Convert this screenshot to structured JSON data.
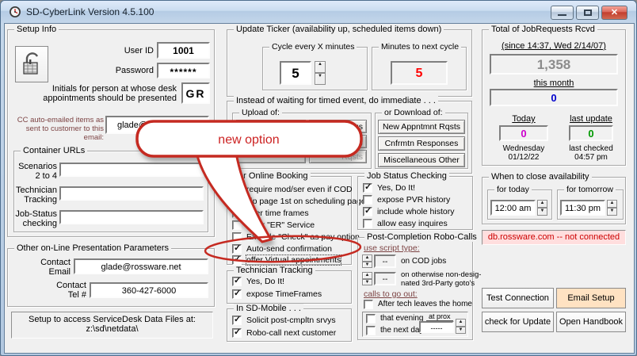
{
  "window": {
    "title": "SD-CyberLink Version 4.5.100"
  },
  "icons": {
    "spinner_up": "▲",
    "spinner_down": "▼",
    "close": "✕"
  },
  "callout": {
    "text": "new option"
  },
  "setup_info": {
    "label": "Setup Info",
    "user_id_label": "User ID",
    "user_id_value": "1001",
    "password_label": "Password",
    "password_value": "******",
    "initials_label_line1": "Initials for person at whose desk",
    "initials_label_line2": "appointments should be presented",
    "initials_value": "GR",
    "cc_label_line1": "CC auto-emailed items as",
    "cc_label_line2": "sent to customer to this email:",
    "cc_value": "glade@rossware.net",
    "container_urls": {
      "label": "Container URLs",
      "rows": [
        {
          "label_line1": "Scenarios",
          "label_line2": "2 to 4",
          "value": ""
        },
        {
          "label_line1": "Technician",
          "label_line2": "Tracking",
          "value": ""
        },
        {
          "label_line1": "Job-Status",
          "label_line2": "checking",
          "value": ""
        }
      ]
    }
  },
  "other_params": {
    "label": "Other on-Line Presentation Parameters",
    "email_label_line1": "Contact",
    "email_label_line2": "Email",
    "email_value": "glade@rossware.net",
    "tel_label_line1": "Contact",
    "tel_label_line2": "Tel #",
    "tel_value": "360-427-6000"
  },
  "data_files_note": {
    "line1": "Setup to access ServiceDesk Data Files at:",
    "line2": "z:\\sd\\netdata\\"
  },
  "update_ticker": {
    "label": "Update Ticker (availability up, scheduled items down)",
    "cycle_label": "Cycle every X minutes",
    "cycle_value": "5",
    "next_label": "Minutes to next cycle",
    "next_value": "5"
  },
  "immediate": {
    "label": "Instead of waiting for timed event, do immediate . . .",
    "upload": {
      "label": "Upload of:",
      "visible_fragments": [
        "tus",
        "king",
        "Rqsts"
      ]
    },
    "download": {
      "label": "or Download of:",
      "buttons": [
        "New Appntmnt Rqsts",
        "Cnfrmtn Responses",
        "Miscellaneous Other"
      ]
    }
  },
  "online_booking": {
    "label": "for Online Booking",
    "items": [
      {
        "label": "require mod/ser even if COD",
        "check": ""
      },
      {
        "label": "zip page 1st on scheduling page",
        "check": ""
      },
      {
        "label": "offer time frames",
        "check": "✓"
      },
      {
        "label": "Offer \"ER\" Service",
        "check": ""
      },
      {
        "label": "Exclude \"Check\" as pay option",
        "check": ""
      },
      {
        "label": "Auto-send confirmation",
        "check": "✓"
      },
      {
        "label": "offer Virtual appointments",
        "check": "✓"
      }
    ]
  },
  "technician_tracking": {
    "label": "Technician Tracking",
    "items": [
      {
        "label": "Yes, Do It!",
        "check": "✓"
      },
      {
        "label": "expose TimeFrames",
        "check": "✓"
      }
    ]
  },
  "sd_mobile": {
    "label": "In SD-Mobile . . .",
    "items": [
      {
        "label": "Solicit post-cmpltn srvys",
        "check": "✓"
      },
      {
        "label": "Robo-call next customer",
        "check": "✓"
      }
    ]
  },
  "job_status_checking": {
    "label": "Job Status Checking",
    "items": [
      {
        "label": "Yes, Do It!",
        "check": "✓"
      },
      {
        "label": "expose PVR history",
        "check": ""
      },
      {
        "label": "include whole history",
        "check": "✓"
      },
      {
        "label": "allow easy inquires",
        "check": ""
      }
    ]
  },
  "robo_calls": {
    "label": "Post-Completion Robo-Calls",
    "script_type_label": "use script type:",
    "cod_value": "--",
    "cod_text": "on COD jobs",
    "other_value": "--",
    "other_text_line1": "on otherwise non-desig-",
    "other_text_line2": "nated 3rd-Party goto's",
    "go_out_label": "calls to go out:",
    "after_tech": {
      "label": "After tech leaves the home",
      "check": ""
    },
    "that_evening": {
      "label": "that evening",
      "check": ""
    },
    "next_day": {
      "label": "the next day",
      "check": ""
    },
    "at_prox_label": "at prox",
    "at_prox_value": "-----"
  },
  "totals": {
    "label": "Total of JobRequests Rcvd",
    "since_label": "(since 14:37, Wed 2/14/07)",
    "total_value": "1,358",
    "month_label": "this month",
    "month_value": "0",
    "today_label": "Today",
    "today_value": "0",
    "today_day": "Wednesday",
    "today_date": "01/12/22",
    "update_label": "last update",
    "update_value": "0",
    "checked_label": "last checked",
    "checked_time": "04:57 pm"
  },
  "availability": {
    "label": "When to close availability",
    "today_label": "for today",
    "today_value": "12:00 am",
    "tomorrow_label": "for tomorrow",
    "tomorrow_value": "11:30 pm"
  },
  "status_text": "db.rossware.com -- not connected",
  "action_buttons": {
    "test": "Test Connection",
    "email": "Email Setup",
    "update": "check for Update",
    "handbook": "Open Handbook"
  },
  "colors": {
    "accent_red": "#cc2222",
    "status_red": "#cc0000",
    "value_blue": "#0000cc",
    "value_magenta": "#cc00cc",
    "value_green": "#009900",
    "value_gray": "#8c8c8c",
    "email_btn_bg": "#ffe2c2"
  }
}
